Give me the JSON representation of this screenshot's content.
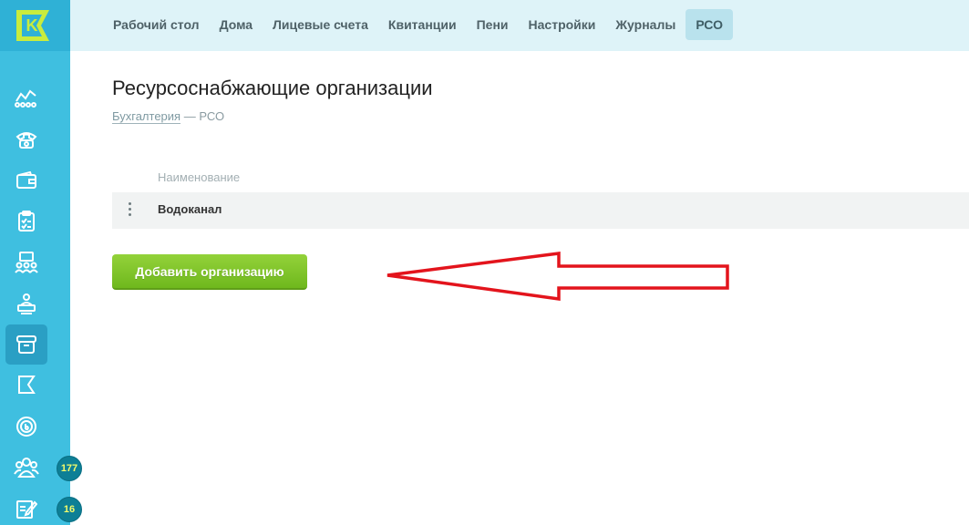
{
  "app": {
    "logo_letter": "K"
  },
  "topnav": {
    "items": [
      {
        "label": "Рабочий стол"
      },
      {
        "label": "Дома"
      },
      {
        "label": "Лицевые счета"
      },
      {
        "label": "Квитанции"
      },
      {
        "label": "Пени"
      },
      {
        "label": "Настройки"
      },
      {
        "label": "Журналы"
      },
      {
        "label": "РСО",
        "active": true
      }
    ]
  },
  "sidebar": {
    "icons": [
      {
        "name": "analytics-icon"
      },
      {
        "name": "phone-icon"
      },
      {
        "name": "wallet-icon"
      },
      {
        "name": "clipboard-check-icon"
      },
      {
        "name": "people-board-icon"
      },
      {
        "name": "accountant-icon"
      },
      {
        "name": "archive-box-icon",
        "active": true
      },
      {
        "name": "flag-icon"
      },
      {
        "name": "coin-icon"
      },
      {
        "name": "group-icon",
        "badge": "177"
      },
      {
        "name": "edit-note-icon",
        "badge": "16"
      }
    ]
  },
  "page": {
    "title": "Ресурсоснабжающие организации",
    "breadcrumb_link": "Бухгалтерия",
    "breadcrumb_sep": " — ",
    "breadcrumb_current": "РСО"
  },
  "table": {
    "column_header": "Наименование",
    "rows": [
      {
        "name": "Водоканал"
      }
    ]
  },
  "actions": {
    "add_label": "Добавить организацию"
  },
  "colors": {
    "sidebar": "#3fbfe0",
    "topbar": "#def3f8",
    "add_button": "#7ec22b",
    "annotation_arrow": "#e3141c"
  }
}
